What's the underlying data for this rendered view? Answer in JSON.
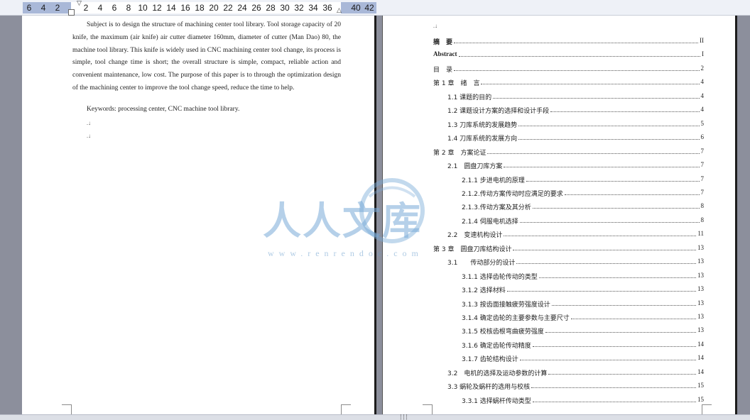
{
  "ruler": {
    "left_numbers": [
      "6",
      "4",
      "2"
    ],
    "main_numbers": [
      "2",
      "4",
      "6",
      "8",
      "10",
      "12",
      "14",
      "16",
      "18",
      "20",
      "22",
      "24",
      "26",
      "28",
      "30",
      "32",
      "34",
      "36"
    ],
    "right_numbers": [
      "40",
      "42"
    ],
    "indent_marker": "▽",
    "tab_marker": "△"
  },
  "left_page": {
    "abstract": "Subject is to design the structure of machining center tool library. Tool storage capacity of 20 knife, the maximum (air knife) air cutter diameter 160mm, diameter of cutter (Man Dao) 80, the machine tool library. This knife is widely used in CNC machining center tool change, its process is simple, tool change time is short; the overall structure is simple, compact, reliable action and convenient maintenance, low cost. The purpose of this paper is to through the optimization design of the machining center to improve the tool change speed, reduce the time to help.",
    "keywords": "Keywords: processing center, CNC machine tool library.",
    "paragraph_mark": ".↓"
  },
  "right_page": {
    "top_mark": ".↓",
    "toc": [
      {
        "label": "摘　要",
        "page": "II",
        "level": 0,
        "bold": true
      },
      {
        "label": "Abstract",
        "page": "I",
        "level": 0,
        "bold": true
      },
      {
        "label": "目　录",
        "page": "2",
        "level": 0,
        "bold": false
      },
      {
        "label": "第 1 章　绪　言",
        "page": "4",
        "level": 0,
        "bold": false
      },
      {
        "label": "1.1 课题的目的",
        "page": "4",
        "level": 1,
        "bold": false
      },
      {
        "label": "1.2 课题设计方案的选择和设计手段",
        "page": "4",
        "level": 1,
        "bold": false
      },
      {
        "label": "1.3 刀库系统的发展趋势",
        "page": "5",
        "level": 1,
        "bold": false
      },
      {
        "label": "1.4 刀库系统的发展方向",
        "page": "6",
        "level": 1,
        "bold": false
      },
      {
        "label": "第 2 章　方案论证",
        "page": "7",
        "level": 0,
        "bold": false
      },
      {
        "label": "2.1　圆盘刀库方案",
        "page": "7",
        "level": 1,
        "bold": false
      },
      {
        "label": "2.1.1 步进电机的原理",
        "page": "7",
        "level": 2,
        "bold": false
      },
      {
        "label": "2.1.2.传动方案传动时应满足的要求",
        "page": "7",
        "level": 2,
        "bold": false
      },
      {
        "label": "2.1.3.传动方案及其分析",
        "page": "8",
        "level": 2,
        "bold": false
      },
      {
        "label": "2.1.4 伺服电机选择",
        "page": "8",
        "level": 2,
        "bold": false
      },
      {
        "label": "2.2　变速机构设计",
        "page": "11",
        "level": 1,
        "bold": false
      },
      {
        "label": "第 3 章　圆盘刀库结构设计",
        "page": "13",
        "level": 0,
        "bold": false
      },
      {
        "label": "3.1　　传动部分的设计",
        "page": "13",
        "level": 1,
        "bold": false
      },
      {
        "label": "3.1.1 选择齿轮传动的类型",
        "page": "13",
        "level": 2,
        "bold": false
      },
      {
        "label": "3.1.2 选择材料",
        "page": "13",
        "level": 2,
        "bold": false
      },
      {
        "label": "3.1.3 按齿面接触疲劳强度设计",
        "page": "13",
        "level": 2,
        "bold": false
      },
      {
        "label": "3.1.4 确定齿轮的主要参数与主要尺寸",
        "page": "13",
        "level": 2,
        "bold": false
      },
      {
        "label": "3.1.5 校核齿根弯曲疲劳强度",
        "page": "13",
        "level": 2,
        "bold": false
      },
      {
        "label": "3.1.6 确定齿轮传动精度",
        "page": "14",
        "level": 2,
        "bold": false
      },
      {
        "label": "3.1.7 齿轮结构设计",
        "page": "14",
        "level": 2,
        "bold": false
      },
      {
        "label": "3.2　电机的选择及运动参数的计算",
        "page": "14",
        "level": 1,
        "bold": false
      },
      {
        "label": "3.3 蜗轮及蜗杆的选用与校核",
        "page": "15",
        "level": 1,
        "bold": false
      },
      {
        "label": "3.3.1 选择蜗杆传动类型",
        "page": "15",
        "level": 2,
        "bold": false
      }
    ]
  },
  "watermark": {
    "text": "人人文库",
    "url": "www.renrendoc.com"
  },
  "scrollbar": {
    "grip": "┆┆┆"
  }
}
